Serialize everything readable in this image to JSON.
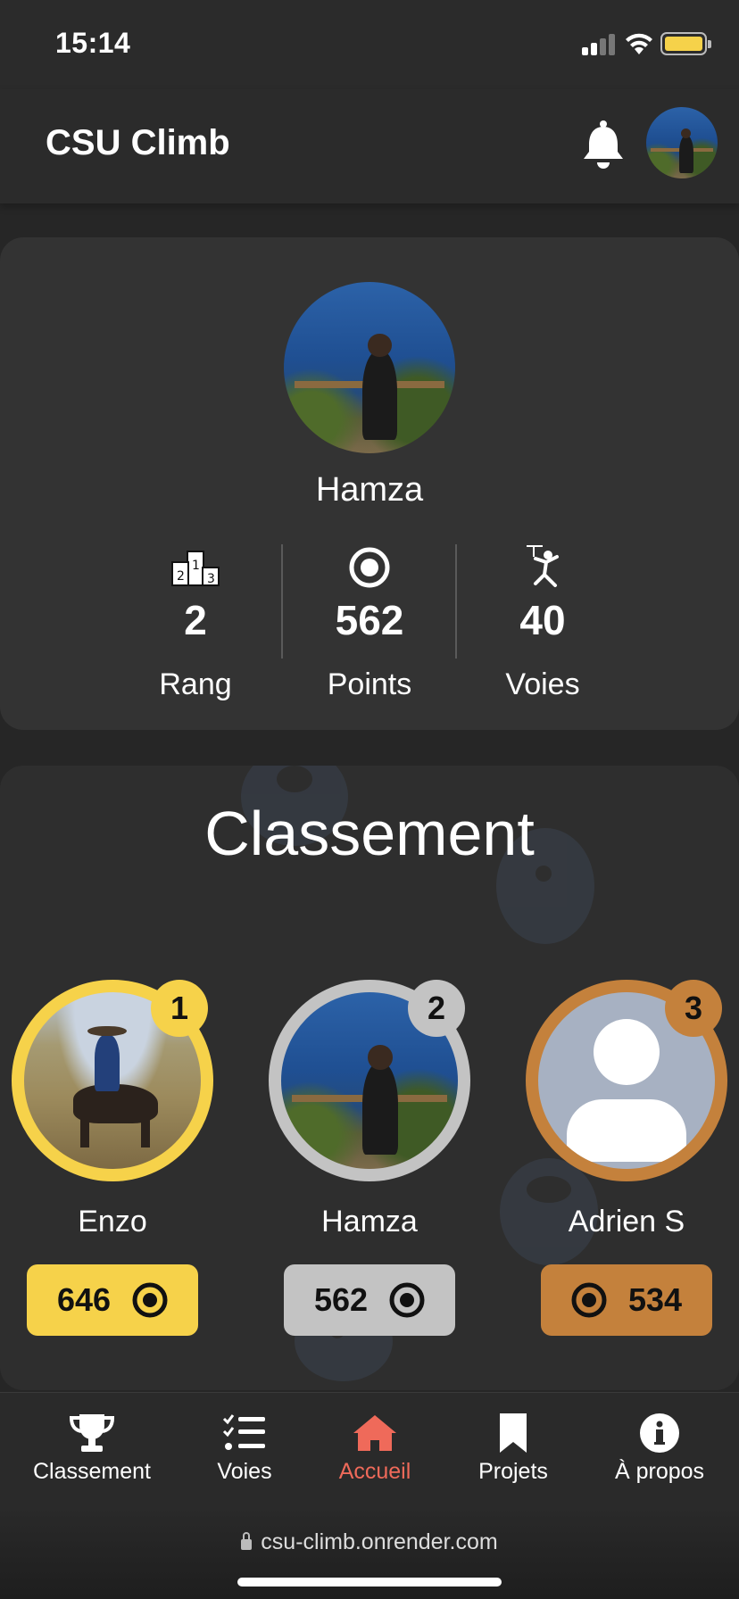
{
  "status_bar": {
    "time": "15:14"
  },
  "header": {
    "title": "CSU Climb"
  },
  "profile": {
    "name": "Hamza",
    "stats": [
      {
        "value": "2",
        "label": "Rang",
        "icon": "podium-icon"
      },
      {
        "value": "562",
        "label": "Points",
        "icon": "target-icon"
      },
      {
        "value": "40",
        "label": "Voies",
        "icon": "climber-icon"
      }
    ]
  },
  "leaderboard": {
    "title": "Classement",
    "entries": [
      {
        "rank": "1",
        "name": "Enzo",
        "points": "646",
        "color": "#f6d24a"
      },
      {
        "rank": "2",
        "name": "Hamza",
        "points": "562",
        "color": "#c3c3c3"
      },
      {
        "rank": "3",
        "name": "Adrien S",
        "points": "534",
        "color": "#c4813c"
      }
    ]
  },
  "nav": {
    "items": [
      {
        "label": "Classement",
        "icon": "trophy-icon"
      },
      {
        "label": "Voies",
        "icon": "checklist-icon"
      },
      {
        "label": "Accueil",
        "icon": "home-icon",
        "active": true
      },
      {
        "label": "Projets",
        "icon": "bookmark-icon"
      },
      {
        "label": "À propos",
        "icon": "info-icon"
      }
    ],
    "active_color": "#ef6a5a"
  },
  "browser": {
    "url": "csu-climb.onrender.com"
  }
}
